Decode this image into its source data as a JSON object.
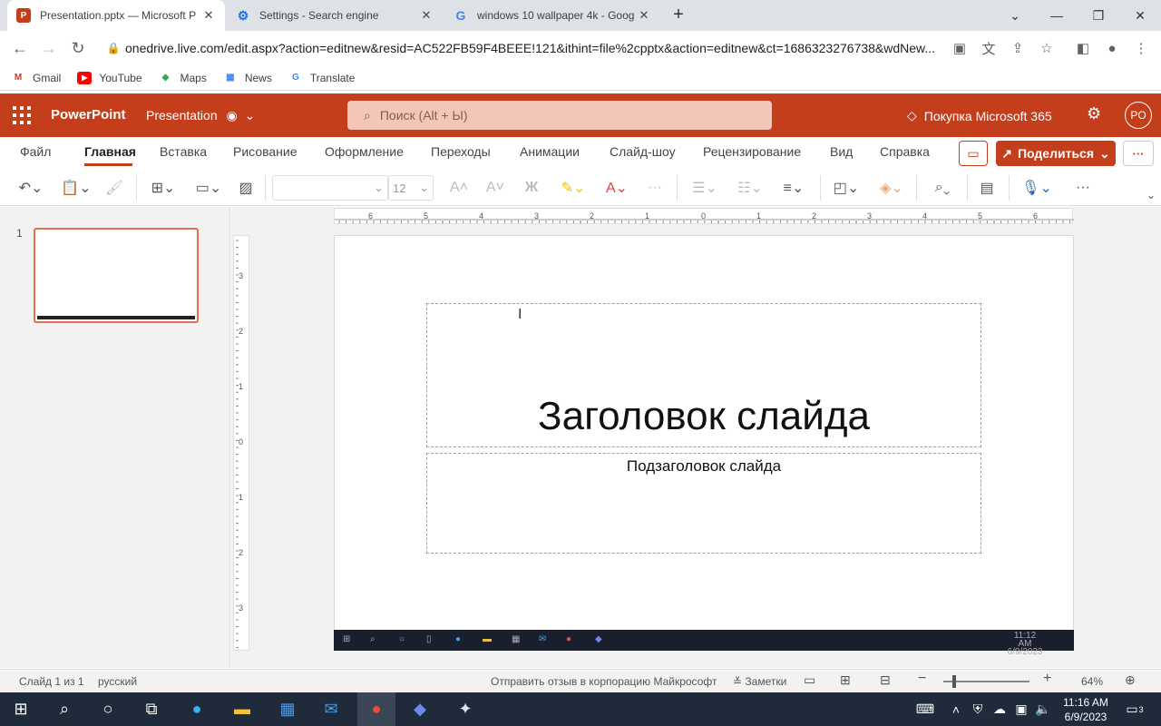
{
  "browser": {
    "tabs": [
      {
        "title": "Presentation.pptx — Microsoft P",
        "icon": "powerpoint-icon",
        "active": true
      },
      {
        "title": "Settings - Search engine",
        "icon": "gear-icon",
        "active": false
      },
      {
        "title": "windows 10 wallpaper 4k - Goog",
        "icon": "google-icon",
        "active": false
      }
    ],
    "url": "onedrive.live.com/edit.aspx?action=editnew&resid=AC522FB59F4BEEE!121&ithint=file%2cpptx&action=editnew&ct=1686323276738&wdNew...",
    "bookmarks": [
      {
        "label": "Gmail",
        "icon": "gmail-icon",
        "color": "#d93025"
      },
      {
        "label": "YouTube",
        "icon": "youtube-icon",
        "color": "#ff0000"
      },
      {
        "label": "Maps",
        "icon": "maps-icon",
        "color": "#34a853"
      },
      {
        "label": "News",
        "icon": "news-icon",
        "color": "#4285f4"
      },
      {
        "label": "Translate",
        "icon": "translate-icon",
        "color": "#4285f4"
      }
    ]
  },
  "app": {
    "name": "PowerPoint",
    "doc_name": "Presentation",
    "search_placeholder": "Поиск (Alt + Ы)",
    "buy_label": "Покупка Microsoft 365",
    "avatar_initials": "PO",
    "accent": "#c43e1c"
  },
  "ribbon": {
    "tabs": [
      "Файл",
      "Главная",
      "Вставка",
      "Рисование",
      "Оформление",
      "Переходы",
      "Анимации",
      "Слайд-шоу",
      "Рецензирование",
      "Вид",
      "Справка"
    ],
    "active_tab": "Главная",
    "share_label": "Поделиться",
    "font_size": "12"
  },
  "slides": {
    "thumb_number": "1",
    "title_text": "Заголовок слайда",
    "subtitle_text": "Подзаголовок слайда",
    "embedded_time": "11:12 AM",
    "embedded_date": "6/9/2023"
  },
  "status": {
    "slide_count": "Слайд 1 из 1",
    "language": "русский",
    "feedback": "Отправить отзыв в корпорацию Майкрософт",
    "notes": "Заметки",
    "zoom": "64%"
  },
  "taskbar": {
    "time": "11:16 AM",
    "date": "6/9/2023",
    "notifications": "3"
  }
}
